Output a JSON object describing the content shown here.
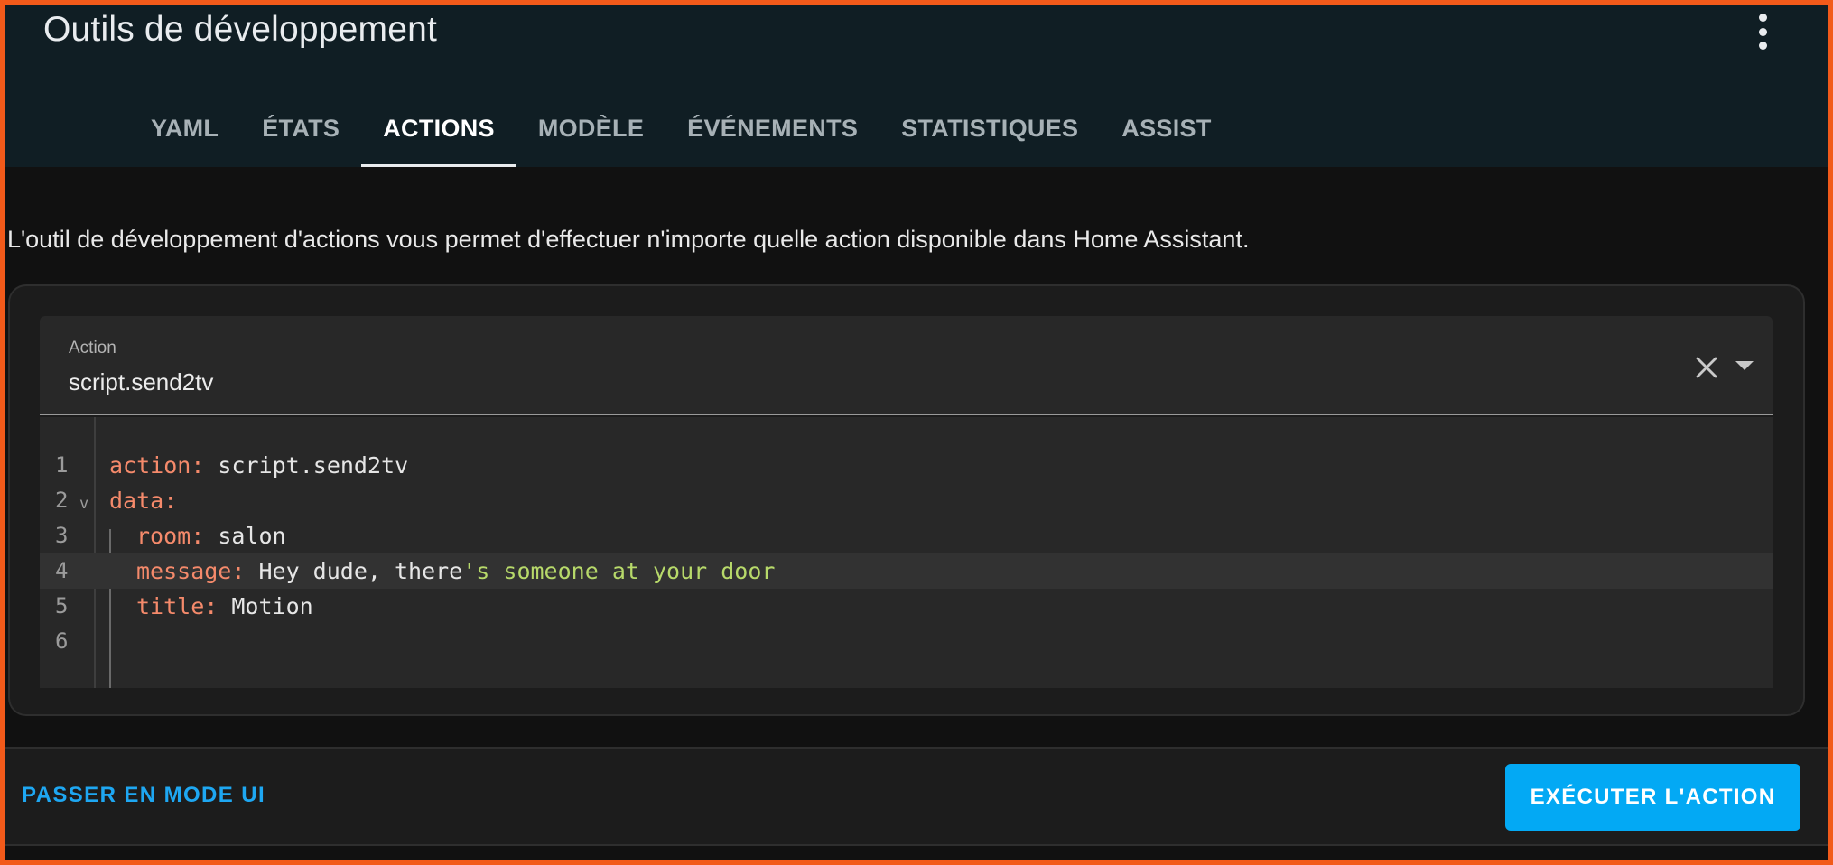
{
  "header": {
    "title": "Outils de développement",
    "menu_icon": "more-vertical-icon",
    "tabs": [
      {
        "label": "YAML",
        "active": false
      },
      {
        "label": "ÉTATS",
        "active": false
      },
      {
        "label": "ACTIONS",
        "active": true
      },
      {
        "label": "MODÈLE",
        "active": false
      },
      {
        "label": "ÉVÉNEMENTS",
        "active": false
      },
      {
        "label": "STATISTIQUES",
        "active": false
      },
      {
        "label": "ASSIST",
        "active": false
      }
    ]
  },
  "main": {
    "description": "L'outil de développement d'actions vous permet d'effectuer n'importe quelle action disponible dans Home Assistant.",
    "action_field": {
      "label": "Action",
      "value": "script.send2tv",
      "clear_icon": "close-icon",
      "dropdown_icon": "caret-down-icon"
    },
    "editor": {
      "line_numbers": [
        "1",
        "2",
        "3",
        "4",
        "5",
        "6"
      ],
      "fold_marker": "v",
      "lines": [
        {
          "key": "action",
          "sep": ": ",
          "value": "script.send2tv",
          "string_part": ""
        },
        {
          "key": "data",
          "sep": ":",
          "value": "",
          "string_part": ""
        },
        {
          "key": "room",
          "sep": ": ",
          "value": "salon",
          "string_part": ""
        },
        {
          "key": "message",
          "sep": ": ",
          "value": "Hey dude, there",
          "string_part": "'s someone at your door"
        },
        {
          "key": "title",
          "sep": ": ",
          "value": "Motion",
          "string_part": ""
        },
        {
          "key": "",
          "sep": "",
          "value": "",
          "string_part": ""
        }
      ]
    }
  },
  "footer": {
    "ui_mode_label": "PASSER EN MODE UI",
    "run_label": "EXÉCUTER L'ACTION"
  },
  "colors": {
    "accent": "#03a9f4",
    "header_bg": "#101e24",
    "yaml_key": "#f58a6b",
    "yaml_string": "#b7d96a"
  }
}
